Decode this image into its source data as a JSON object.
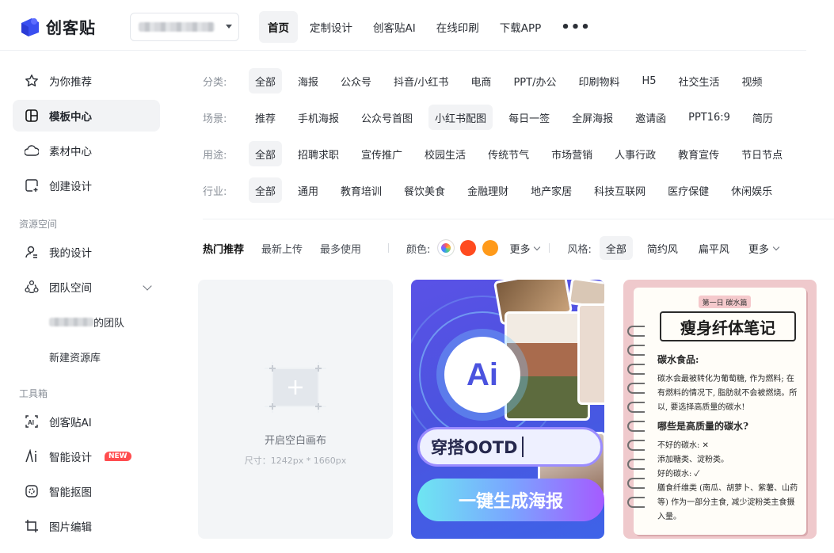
{
  "app": {
    "logo_text": "创客贴",
    "brand_color": "#3a4ff0"
  },
  "header": {
    "nav": [
      "首页",
      "定制设计",
      "创客贴AI",
      "在线印刷",
      "下载APP"
    ],
    "more": "•••"
  },
  "sidebar": {
    "main": [
      {
        "label": "为你推荐",
        "icon": "star-icon"
      },
      {
        "label": "模板中心",
        "icon": "template-icon"
      },
      {
        "label": "素材中心",
        "icon": "shapes-icon"
      },
      {
        "label": "创建设计",
        "icon": "add-design-icon"
      }
    ],
    "resource_title": "资源空间",
    "resource": [
      {
        "label": "我的设计",
        "icon": "user-icon"
      },
      {
        "label": "团队空间",
        "icon": "team-icon"
      }
    ],
    "team_sub_suffix": "的团队",
    "new_library": "新建资源库",
    "tools_title": "工具箱",
    "tools": [
      {
        "label": "创客贴AI",
        "icon": "ai-icon"
      },
      {
        "label": "智能设计",
        "icon": "ai-design-icon",
        "badge": "NEW"
      },
      {
        "label": "智能抠图",
        "icon": "cutout-icon"
      },
      {
        "label": "图片编辑",
        "icon": "crop-icon"
      }
    ]
  },
  "filters": [
    {
      "label": "分类:",
      "items": [
        "全部",
        "海报",
        "公众号",
        "抖音/小红书",
        "电商",
        "PPT/办公",
        "印刷物料",
        "H5",
        "社交生活",
        "视频"
      ],
      "active": 0
    },
    {
      "label": "场景:",
      "items": [
        "推荐",
        "手机海报",
        "公众号首图",
        "小红书配图",
        "每日一签",
        "全屏海报",
        "邀请函",
        "PPT16:9",
        "简历"
      ],
      "active": 3
    },
    {
      "label": "用途:",
      "items": [
        "全部",
        "招聘求职",
        "宣传推广",
        "校园生活",
        "传统节气",
        "市场营销",
        "人事行政",
        "教育宣传",
        "节日节点"
      ],
      "active": 0
    },
    {
      "label": "行业:",
      "items": [
        "全部",
        "通用",
        "教育培训",
        "餐饮美食",
        "金融理财",
        "地产家居",
        "科技互联网",
        "医疗保健",
        "休闲娱乐"
      ],
      "active": 0
    }
  ],
  "sort": {
    "items": [
      "热门推荐",
      "最新上传",
      "最多使用"
    ],
    "active": 0
  },
  "color_filter": {
    "label": "颜色:",
    "colors": [
      "#6a5cff",
      "#ff4b1f",
      "#ff9a1a"
    ],
    "more": "更多"
  },
  "style_filter": {
    "label": "风格:",
    "items": [
      "全部",
      "简约风",
      "扁平风"
    ],
    "active": 0,
    "more": "更多"
  },
  "blank_card": {
    "title": "开启空白画布",
    "size": "尺寸：1242px * 1660px"
  },
  "ai_card": {
    "logo": "Ai",
    "input_text": "穿搭OOTD",
    "button": "一键生成海报"
  },
  "note_card": {
    "tag": "第一日 碳水篇",
    "title": "瘦身纤体笔记",
    "lines": [
      {
        "text": "碳水食品:",
        "h": true
      },
      {
        "text": "碳水会最被转化为葡萄糖, 作为燃料; 在"
      },
      {
        "text": "有燃料的情况下, 脂肪就不会被燃烧。所"
      },
      {
        "text": "以, 要选择高质量的碳水!"
      },
      {
        "text": "哪些是高质量的碳水?",
        "h": true
      },
      {
        "text": "不好的碳水: ✕"
      },
      {
        "text": "添加糖类、淀粉类。"
      },
      {
        "text": "好的碳水: ✓"
      },
      {
        "text": "膳食纤维类 (南瓜、胡萝卜、紫薯、山药"
      },
      {
        "text": "等) 作为一部分主食, 减少淀粉类主食摄"
      },
      {
        "text": "入量。"
      }
    ]
  }
}
